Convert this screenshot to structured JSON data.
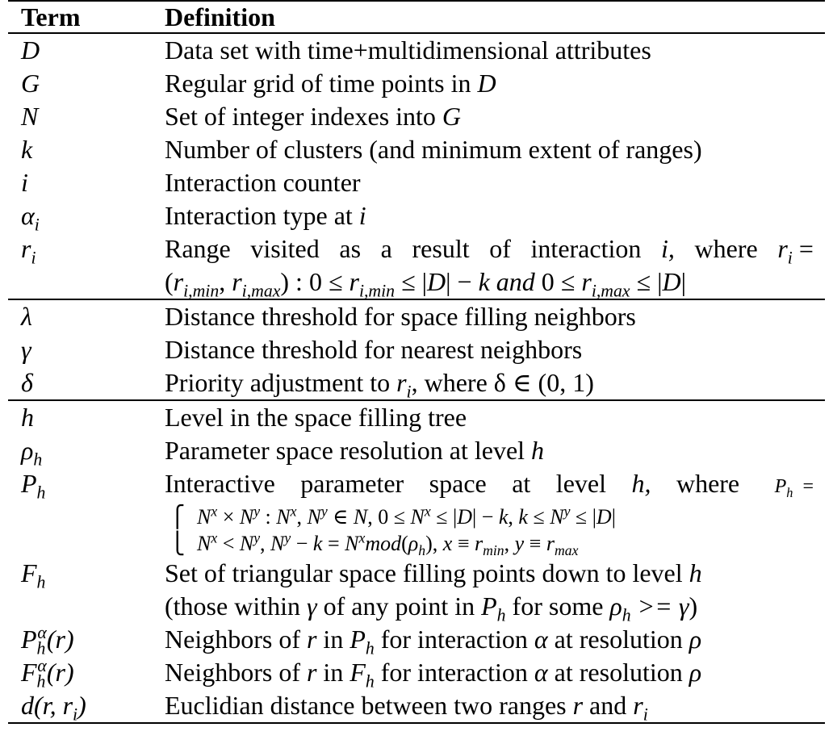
{
  "header": {
    "term": "Term",
    "definition": "Definition"
  },
  "rows": {
    "D": {
      "term": "D",
      "def": "Data set with time+multidimensional attributes"
    },
    "G": {
      "term": "G",
      "def_a": "Regular grid of time points in ",
      "def_b": "D"
    },
    "N": {
      "term": "N",
      "def_a": "Set of integer indexes into ",
      "def_b": "G"
    },
    "k": {
      "term": "k",
      "def": "Number of clusters (and minimum extent of ranges)"
    },
    "i": {
      "term": "i",
      "def": "Interaction counter"
    },
    "alpha": {
      "term": "α",
      "sub": "i",
      "def_a": "Interaction type at ",
      "def_b": "i"
    },
    "r": {
      "term": "r",
      "sub": "i",
      "line1": "Range visited as a result of interaction i, where r",
      "line1_sub": "i",
      "line1_end": " =",
      "line2": "(r",
      "line2_rest": "i,min, r i,max) : 0 ≤ r i,min ≤ |D| − k and 0 ≤ r i,max ≤ |D|"
    },
    "lambda": {
      "term": "λ",
      "def": "Distance threshold for space filling neighbors"
    },
    "gamma": {
      "term": "γ",
      "def": "Distance threshold for nearest neighbors"
    },
    "delta": {
      "term": "δ",
      "def_a": "Priority adjustment to ",
      "def_b": ", where δ ∈ (0, 1)"
    },
    "h": {
      "term": "h",
      "def": "Level in the space filling tree"
    },
    "rho": {
      "term": "ρ",
      "sub": "h",
      "def_a": "Parameter space resolution at level ",
      "def_b": "h"
    },
    "P": {
      "term": "P",
      "sub": "h",
      "line1": "Interactive parameter space at level h, where",
      "line1_eq": "P",
      "line1_eq_sub": "h",
      "line1_eq_end": "=",
      "case1": "N",
      "case2": "N"
    },
    "F": {
      "term": "F",
      "sub": "h",
      "line1": "Set of triangular space filling points down to level h",
      "line2": "(those within γ of any point in P"
    },
    "Palpha": {
      "term": "P",
      "def": "Neighbors of r in P"
    },
    "Falpha": {
      "term": "F",
      "def": "Neighbors of r in F"
    },
    "d": {
      "term": "d(r, r",
      "def_a": "Euclidian distance between two ranges ",
      "def_b": "r",
      "def_c": " and "
    }
  }
}
